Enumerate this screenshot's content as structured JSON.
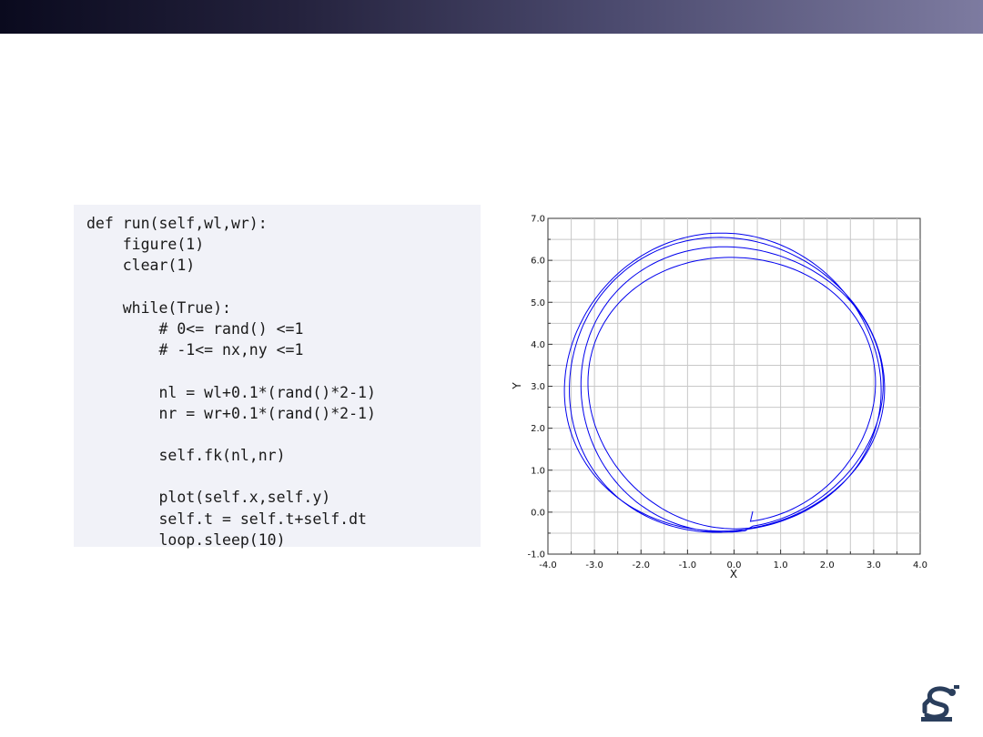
{
  "colors": {
    "header_dark": "#0a0a1e",
    "header_light": "#7d7ba0",
    "code_background": "#f1f2f8",
    "trajectory": "#0000ee",
    "grid": "#c8c8c8",
    "logo": "#2a3e5c"
  },
  "icons": {
    "logo": "robot-arm-logo"
  },
  "code": {
    "lines": [
      "def run(self,wl,wr):",
      "    figure(1)",
      "    clear(1)",
      "",
      "    while(True):",
      "        # 0<= rand() <=1",
      "        # -1<= nx,ny <=1",
      "",
      "        nl = wl+0.1*(rand()*2-1)",
      "        nr = wr+0.1*(rand()*2-1)",
      "",
      "        self.fk(nl,nr)",
      "",
      "        plot(self.x,self.y)",
      "        self.t = self.t+self.dt",
      "        loop.sleep(10)"
    ]
  },
  "chart_data": {
    "type": "line",
    "title": "",
    "xlabel": "X",
    "ylabel": "Y",
    "xlim": [
      -4.0,
      4.0
    ],
    "ylim": [
      -1.0,
      7.0
    ],
    "xticks": [
      "-4.0",
      "-3.0",
      "-2.0",
      "-1.0",
      "0.0",
      "1.0",
      "2.0",
      "3.0",
      "4.0"
    ],
    "yticks": [
      "-1.0",
      "0.0",
      "1.0",
      "2.0",
      "3.0",
      "4.0",
      "5.0",
      "6.0",
      "7.0"
    ],
    "grid": true,
    "legend": "none",
    "series": [
      {
        "description": "noisy near-circular trajectory, about 4 loops, starting near (0.4, 0.02)",
        "start": [
          0.4,
          0.02
        ],
        "loops": [
          {
            "cx": -0.05,
            "cy": 2.9,
            "rx": 3.05,
            "ry": 3.1
          },
          {
            "cx": 0.0,
            "cy": 2.95,
            "rx": 3.15,
            "ry": 3.3
          },
          {
            "cx": -0.1,
            "cy": 3.0,
            "rx": 3.3,
            "ry": 3.45
          },
          {
            "cx": -0.25,
            "cy": 3.05,
            "rx": 3.4,
            "ry": 3.55
          }
        ]
      }
    ]
  }
}
